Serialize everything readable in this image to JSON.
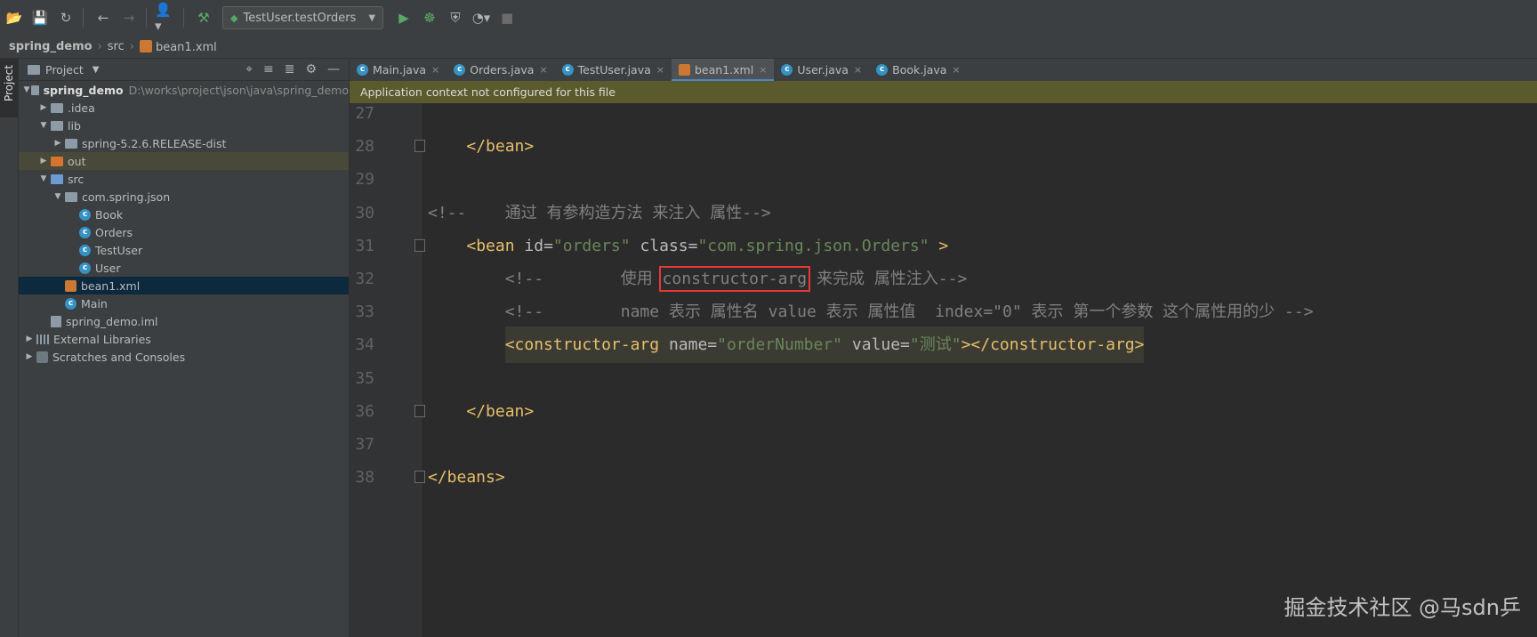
{
  "toolbar": {
    "run_config": "TestUser.testOrders"
  },
  "breadcrumb": [
    "spring_demo",
    "src",
    "bean1.xml"
  ],
  "sidebar_tab": "Project",
  "project": {
    "title": "Project",
    "tree": [
      {
        "label": "spring_demo",
        "path": "D:\\works\\project\\json\\java\\spring_demo",
        "indent": 0,
        "arrow": "down",
        "icon": "module"
      },
      {
        "label": ".idea",
        "indent": 1,
        "arrow": "right",
        "icon": "folder"
      },
      {
        "label": "lib",
        "indent": 1,
        "arrow": "down",
        "icon": "folder"
      },
      {
        "label": "spring-5.2.6.RELEASE-dist",
        "indent": 2,
        "arrow": "right",
        "icon": "folder"
      },
      {
        "label": "out",
        "indent": 1,
        "arrow": "right",
        "icon": "folder-orange"
      },
      {
        "label": "src",
        "indent": 1,
        "arrow": "down",
        "icon": "folder-blue"
      },
      {
        "label": "com.spring.json",
        "indent": 2,
        "arrow": "down",
        "icon": "folder"
      },
      {
        "label": "Book",
        "indent": 3,
        "arrow": "",
        "icon": "class"
      },
      {
        "label": "Orders",
        "indent": 3,
        "arrow": "",
        "icon": "class"
      },
      {
        "label": "TestUser",
        "indent": 3,
        "arrow": "",
        "icon": "class"
      },
      {
        "label": "User",
        "indent": 3,
        "arrow": "",
        "icon": "class"
      },
      {
        "label": "bean1.xml",
        "indent": 2,
        "arrow": "",
        "icon": "xml"
      },
      {
        "label": "Main",
        "indent": 2,
        "arrow": "",
        "icon": "class"
      },
      {
        "label": "spring_demo.iml",
        "indent": 1,
        "arrow": "",
        "icon": "iml"
      },
      {
        "label": "External Libraries",
        "indent": 0,
        "arrow": "right",
        "icon": "lib"
      },
      {
        "label": "Scratches and Consoles",
        "indent": 0,
        "arrow": "right",
        "icon": "scratch"
      }
    ]
  },
  "tabs": [
    "Main.java",
    "Orders.java",
    "TestUser.java",
    "bean1.xml",
    "User.java",
    "Book.java"
  ],
  "active_tab": "bean1.xml",
  "banner": "Application context not configured for this file",
  "editor": {
    "lines": [
      {
        "n": "27",
        "parts": []
      },
      {
        "n": "28",
        "fold": true,
        "parts": [
          [
            "",
            "    "
          ],
          [
            "t-tag",
            "</bean>"
          ]
        ]
      },
      {
        "n": "29",
        "parts": []
      },
      {
        "n": "30",
        "parts": [
          [
            "t-com",
            "<!--    通过 有参构造方法 来注入 属性-->"
          ]
        ]
      },
      {
        "n": "31",
        "fold": true,
        "parts": [
          [
            "",
            "    "
          ],
          [
            "t-tag",
            "<bean "
          ],
          [
            "t-attr",
            "id="
          ],
          [
            "t-val",
            "\"orders\""
          ],
          [
            "t-attr",
            " class="
          ],
          [
            "t-val",
            "\"com.spring.json.Orders\""
          ],
          [
            "t-tag",
            " >"
          ]
        ]
      },
      {
        "n": "32",
        "parts": [
          [
            "",
            "        "
          ],
          [
            "t-com",
            "<!--        使用 "
          ],
          [
            "t-com redbox",
            "constructor-arg"
          ],
          [
            "t-com",
            " 来完成 属性注入-->"
          ]
        ]
      },
      {
        "n": "33",
        "parts": [
          [
            "",
            "        "
          ],
          [
            "t-com",
            "<!--        name 表示 属性名 value 表示 属性值  index=\"0\" 表示 第一个参数 这个属性用的少 -->"
          ]
        ]
      },
      {
        "n": "34",
        "hl": true,
        "parts": [
          [
            "",
            "        "
          ],
          [
            "t-tag hlbox",
            "<constructor-arg "
          ],
          [
            "t-attr hlbox",
            "name="
          ],
          [
            "t-val hlbox",
            "\"orderNumber\""
          ],
          [
            "t-attr hlbox",
            " value="
          ],
          [
            "t-val hlbox",
            "\"测试\""
          ],
          [
            "t-tag hlbox",
            "></constructor-arg>"
          ]
        ]
      },
      {
        "n": "35",
        "parts": []
      },
      {
        "n": "36",
        "fold": true,
        "parts": [
          [
            "",
            "    "
          ],
          [
            "t-tag",
            "</bean>"
          ]
        ]
      },
      {
        "n": "37",
        "parts": []
      },
      {
        "n": "38",
        "fold": true,
        "parts": [
          [
            "t-tag",
            "</beans>"
          ]
        ]
      }
    ]
  },
  "watermark": "掘金技术社区 @马sdn乒"
}
